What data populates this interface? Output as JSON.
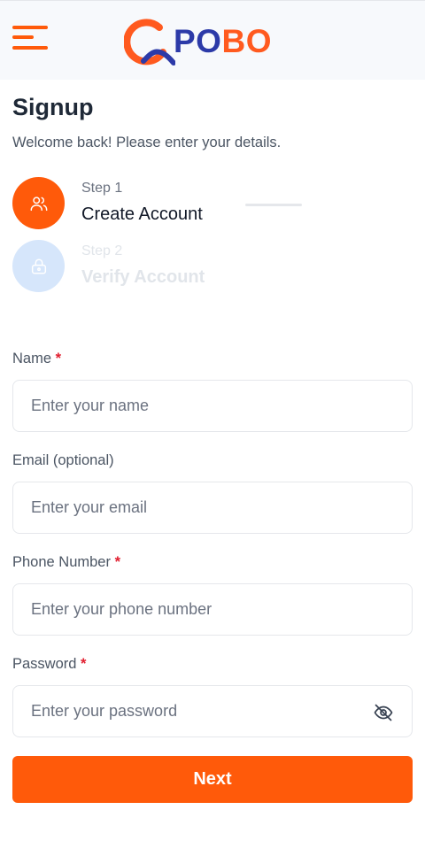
{
  "colors": {
    "accent": "#ff5a0a",
    "brand_blue": "#2c3aa8",
    "step_inactive": "#d6e6fb"
  },
  "header": {
    "menu_icon": "hamburger-menu-icon",
    "logo": {
      "text_a": "PO",
      "text_b": "BO",
      "mark": "Q"
    }
  },
  "page": {
    "title": "Signup",
    "subtitle": "Welcome back! Please enter your details."
  },
  "steps": [
    {
      "number": "Step 1",
      "name": "Create Account",
      "icon": "users-icon",
      "active": true
    },
    {
      "number": "Step 2",
      "name": "Verify Account",
      "icon": "lock-icon",
      "active": false
    }
  ],
  "form": {
    "name": {
      "label": "Name",
      "required_mark": "*",
      "placeholder": "Enter your name",
      "value": ""
    },
    "email": {
      "label": "Email (optional)",
      "placeholder": "Enter your email",
      "value": ""
    },
    "phone": {
      "label": "Phone Number",
      "required_mark": "*",
      "placeholder": "Enter your phone number",
      "value": ""
    },
    "password": {
      "label": "Password",
      "required_mark": "*",
      "placeholder": "Enter your password",
      "value": "",
      "toggle_icon": "eye-off-icon"
    },
    "submit_label": "Next"
  }
}
